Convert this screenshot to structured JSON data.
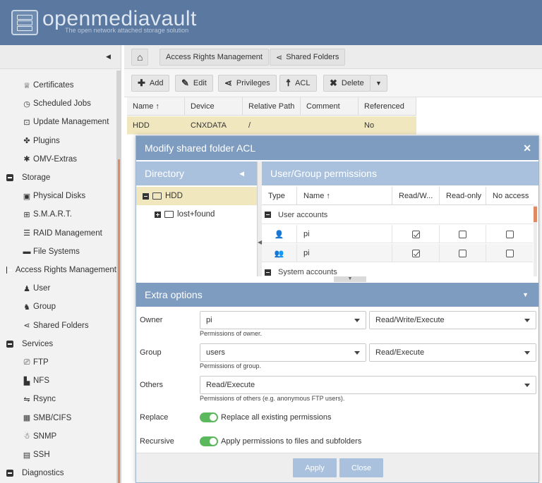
{
  "app": {
    "title": "openmediavault",
    "subtitle": "The open network attached storage solution"
  },
  "sidebar": {
    "items": [
      {
        "label": "Certificates",
        "icon": "certificate-icon",
        "kind": "child"
      },
      {
        "label": "Scheduled Jobs",
        "icon": "clock-icon",
        "kind": "child"
      },
      {
        "label": "Update Management",
        "icon": "update-icon",
        "kind": "child"
      },
      {
        "label": "Plugins",
        "icon": "puzzle-icon",
        "kind": "child"
      },
      {
        "label": "OMV-Extras",
        "icon": "extras-icon",
        "kind": "child"
      },
      {
        "label": "Storage",
        "icon": "collapse-icon",
        "kind": "group"
      },
      {
        "label": "Physical Disks",
        "icon": "disk-icon",
        "kind": "child"
      },
      {
        "label": "S.M.A.R.T.",
        "icon": "smart-icon",
        "kind": "child"
      },
      {
        "label": "RAID Management",
        "icon": "raid-icon",
        "kind": "child"
      },
      {
        "label": "File Systems",
        "icon": "folder-icon",
        "kind": "child"
      },
      {
        "label": "Access Rights Management",
        "icon": "collapse-icon",
        "kind": "group"
      },
      {
        "label": "User",
        "icon": "user-icon",
        "kind": "child"
      },
      {
        "label": "Group",
        "icon": "group-icon",
        "kind": "child"
      },
      {
        "label": "Shared Folders",
        "icon": "share-icon",
        "kind": "child"
      },
      {
        "label": "Services",
        "icon": "collapse-icon",
        "kind": "group"
      },
      {
        "label": "FTP",
        "icon": "ftp-icon",
        "kind": "child"
      },
      {
        "label": "NFS",
        "icon": "nfs-icon",
        "kind": "child"
      },
      {
        "label": "Rsync",
        "icon": "rsync-icon",
        "kind": "child"
      },
      {
        "label": "SMB/CIFS",
        "icon": "windows-icon",
        "kind": "child"
      },
      {
        "label": "SNMP",
        "icon": "snmp-icon",
        "kind": "child"
      },
      {
        "label": "SSH",
        "icon": "terminal-icon",
        "kind": "child"
      },
      {
        "label": "Diagnostics",
        "icon": "collapse-icon",
        "kind": "group"
      }
    ]
  },
  "breadcrumb": {
    "items": [
      "Access Rights Management",
      "Shared Folders"
    ]
  },
  "toolbar": {
    "add": "Add",
    "edit": "Edit",
    "privileges": "Privileges",
    "acl": "ACL",
    "delete": "Delete"
  },
  "grid": {
    "columns": [
      "Name ↑",
      "Device",
      "Relative Path",
      "Comment",
      "Referenced"
    ],
    "rows": [
      [
        "HDD",
        "CNXDATA",
        "/",
        "",
        "No"
      ]
    ]
  },
  "modal": {
    "title": "Modify shared folder ACL",
    "directory": {
      "title": "Directory",
      "tree": [
        "HDD",
        "lost+found"
      ]
    },
    "permissions": {
      "title": "User/Group permissions",
      "columns": [
        "Type",
        "Name ↑",
        "Read/W...",
        "Read-only",
        "No access"
      ],
      "groups": [
        "User accounts",
        "System accounts"
      ],
      "rows": [
        {
          "type_icon": "user-icon",
          "name": "pi",
          "read_write": true,
          "read_only": false,
          "no_access": false
        },
        {
          "type_icon": "group-icon",
          "name": "pi",
          "read_write": true,
          "read_only": false,
          "no_access": false
        }
      ]
    },
    "extra": {
      "title": "Extra options",
      "owner": {
        "label": "Owner",
        "value": "pi",
        "perm": "Read/Write/Execute",
        "hint": "Permissions of owner."
      },
      "group": {
        "label": "Group",
        "value": "users",
        "perm": "Read/Execute",
        "hint": "Permissions of group."
      },
      "others": {
        "label": "Others",
        "perm": "Read/Execute",
        "hint": "Permissions of others (e.g. anonymous FTP users)."
      },
      "replace": {
        "label": "Replace",
        "text": "Replace all existing permissions",
        "on": true
      },
      "recursive": {
        "label": "Recursive",
        "text": "Apply permissions to files and subfolders",
        "on": true
      }
    },
    "buttons": {
      "apply": "Apply",
      "close": "Close"
    }
  },
  "colors": {
    "header": "#5a78a0",
    "modal_header": "#7d9cc0",
    "panel_header": "#a9c1dc",
    "selection": "#f1e7bf",
    "toggle_on": "#5cb85c",
    "scroll_accent": "#e08a63"
  }
}
